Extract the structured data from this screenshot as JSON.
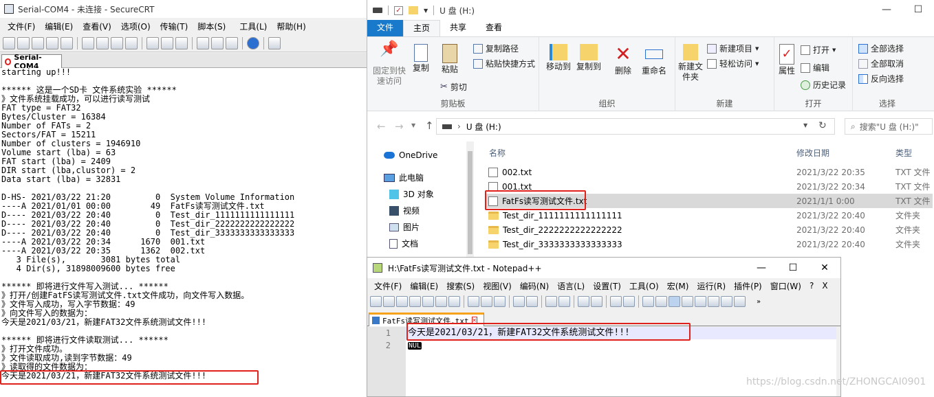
{
  "crt": {
    "title": "Serial-COM4 - 未连接 - SecureCRT",
    "menu": [
      "文件(F)",
      "编辑(E)",
      "查看(V)",
      "选项(O)",
      "传输(T)",
      "脚本(S)",
      "工具(L)",
      "帮助(H)"
    ],
    "tab": "Serial-COM4",
    "lines": [
      "starting up!!!",
      "",
      "****** 这是一个SD卡 文件系统实验 ******",
      "》文件系统挂载成功，可以进行读写测试",
      "FAT type = FAT32",
      "Bytes/Cluster = 16384",
      "Number of FATs = 2",
      "Sectors/FAT = 15211",
      "Number of clusters = 1946910",
      "Volume start (lba) = 63",
      "FAT start (lba) = 2409",
      "DIR start (lba,clustor) = 2",
      "Data start (lba) = 32831",
      "",
      "D-HS- 2021/03/22 21:20         0  System Volume Information",
      "----A 2021/01/01 00:00        49  FatFs读写测试文件.txt",
      "D---- 2021/03/22 20:40         0  Test_dir_1111111111111111",
      "D---- 2021/03/22 20:40         0  Test_dir_2222222222222222",
      "D---- 2021/03/22 20:40         0  Test_dir_3333333333333333",
      "----A 2021/03/22 20:34      1670  001.txt",
      "----A 2021/03/22 20:35      1362  002.txt",
      "   3 File(s),       3081 bytes total",
      "   4 Dir(s), 31898009600 bytes free",
      "",
      "****** 即将进行文件写入测试... ******",
      "》打开/创建FatFS读写测试文件.txt文件成功，向文件写入数据。",
      "》文件写入成功，写入字节数据：49",
      "》向文件写入的数据为：",
      "今天是2021/03/21，新建FAT32文件系统测试文件!!!",
      "",
      "****** 即将进行文件读取测试... ******",
      "》打开文件成功。",
      "》文件读取成功,读到字节数据：49",
      "》读取得的文件数据为：",
      "今天是2021/03/21，新建FAT32文件系统测试文件!!!"
    ]
  },
  "explorer": {
    "title": "U 盘 (H:)",
    "ribbon_tabs": [
      "文件",
      "主页",
      "共享",
      "查看"
    ],
    "ribbon": {
      "pin": "固定到快速访问",
      "copy": "复制",
      "paste": "粘贴",
      "copy_path": "复制路径",
      "paste_shortcut": "粘贴快捷方式",
      "cut": "剪切",
      "g_clipboard": "剪贴板",
      "move_to": "移动到",
      "copy_to": "复制到",
      "g_organize": "组织",
      "delete": "删除",
      "rename": "重命名",
      "new_folder": "新建文件夹",
      "new_item": "新建项目",
      "easy_access": "轻松访问",
      "g_new": "新建",
      "properties": "属性",
      "open": "打开",
      "edit": "编辑",
      "history": "历史记录",
      "g_open": "打开",
      "select_all": "全部选择",
      "select_none": "全部取消",
      "invert": "反向选择",
      "g_select": "选择"
    },
    "address": "U 盘 (H:)",
    "search_placeholder": "搜索\"U 盘 (H:)\"",
    "nav": [
      "OneDrive",
      "此电脑",
      "3D 对象",
      "视频",
      "图片",
      "文档"
    ],
    "columns": [
      "名称",
      "修改日期",
      "类型"
    ],
    "files": [
      {
        "name": "002.txt",
        "date": "2021/3/22 20:35",
        "type": "TXT 文件"
      },
      {
        "name": "001.txt",
        "date": "2021/3/22 20:34",
        "type": "TXT 文件"
      },
      {
        "name": "FatFs读写测试文件.txt",
        "date": "2021/1/1 0:00",
        "type": "TXT 文件"
      },
      {
        "name": "Test_dir_1111111111111111",
        "date": "2021/3/22 20:40",
        "type": "文件夹"
      },
      {
        "name": "Test_dir_2222222222222222",
        "date": "2021/3/22 20:40",
        "type": "文件夹"
      },
      {
        "name": "Test_dir_3333333333333333",
        "date": "2021/3/22 20:40",
        "type": "文件夹"
      }
    ]
  },
  "npp": {
    "title": "H:\\FatFs读写测试文件.txt - Notepad++",
    "menu": [
      "文件(F)",
      "编辑(E)",
      "搜索(S)",
      "视图(V)",
      "编码(N)",
      "语言(L)",
      "设置(T)",
      "工具(O)",
      "宏(M)",
      "运行(R)",
      "插件(P)",
      "窗口(W)",
      "?",
      "X"
    ],
    "tab": "FatFs读写测试文件.txt",
    "line_numbers": [
      "1",
      "2"
    ],
    "line1": "今天是2021/03/21，新建FAT32文件系统测试文件!!!",
    "nul": "NUL"
  },
  "watermark": "https://blog.csdn.net/ZHONGCAI0901",
  "colors": {
    "highlight": "#e0201a",
    "ribbon_file": "#1979ca",
    "folder": "#f7d36c"
  }
}
